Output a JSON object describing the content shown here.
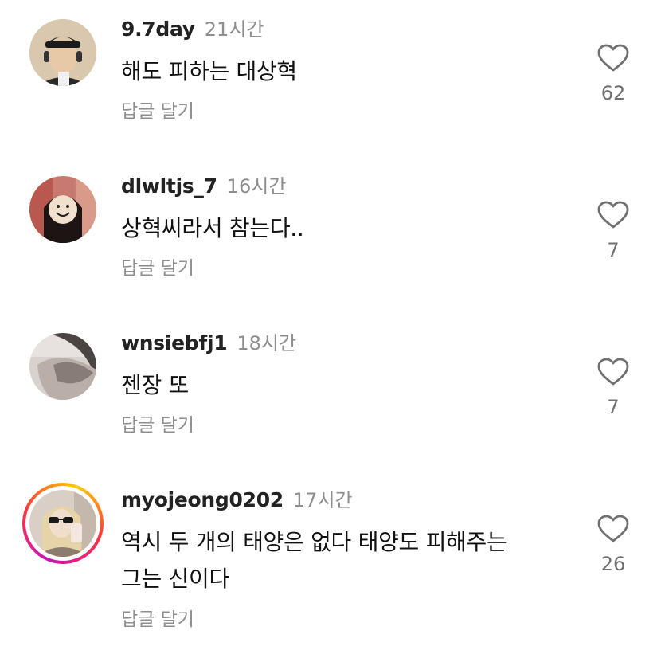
{
  "comments": [
    {
      "username": "9.7day",
      "time": "21시간",
      "lines": [
        "해도 피하는 대상혁"
      ],
      "reply_label": "답글 달기",
      "like_count": "62",
      "avatar": "user-photo-cap"
    },
    {
      "username": "dlwltjs_7",
      "time": "16시간",
      "lines": [
        "상혁씨라서 참는다.."
      ],
      "reply_label": "답글 달기",
      "like_count": "7",
      "avatar": "user-photo-smiley"
    },
    {
      "username": "wnsiebfj1",
      "time": "18시간",
      "lines": [
        "젠장 또"
      ],
      "reply_label": "답글 달기",
      "like_count": "7",
      "avatar": "user-photo-blurred"
    },
    {
      "username": "myojeong0202",
      "time": "17시간",
      "lines": [
        "역시 두 개의 태양은 없다 태양도 피해주는",
        "그는 신이다"
      ],
      "reply_label": "답글 달기",
      "like_count": "26",
      "avatar": "user-photo-story-ring"
    }
  ]
}
